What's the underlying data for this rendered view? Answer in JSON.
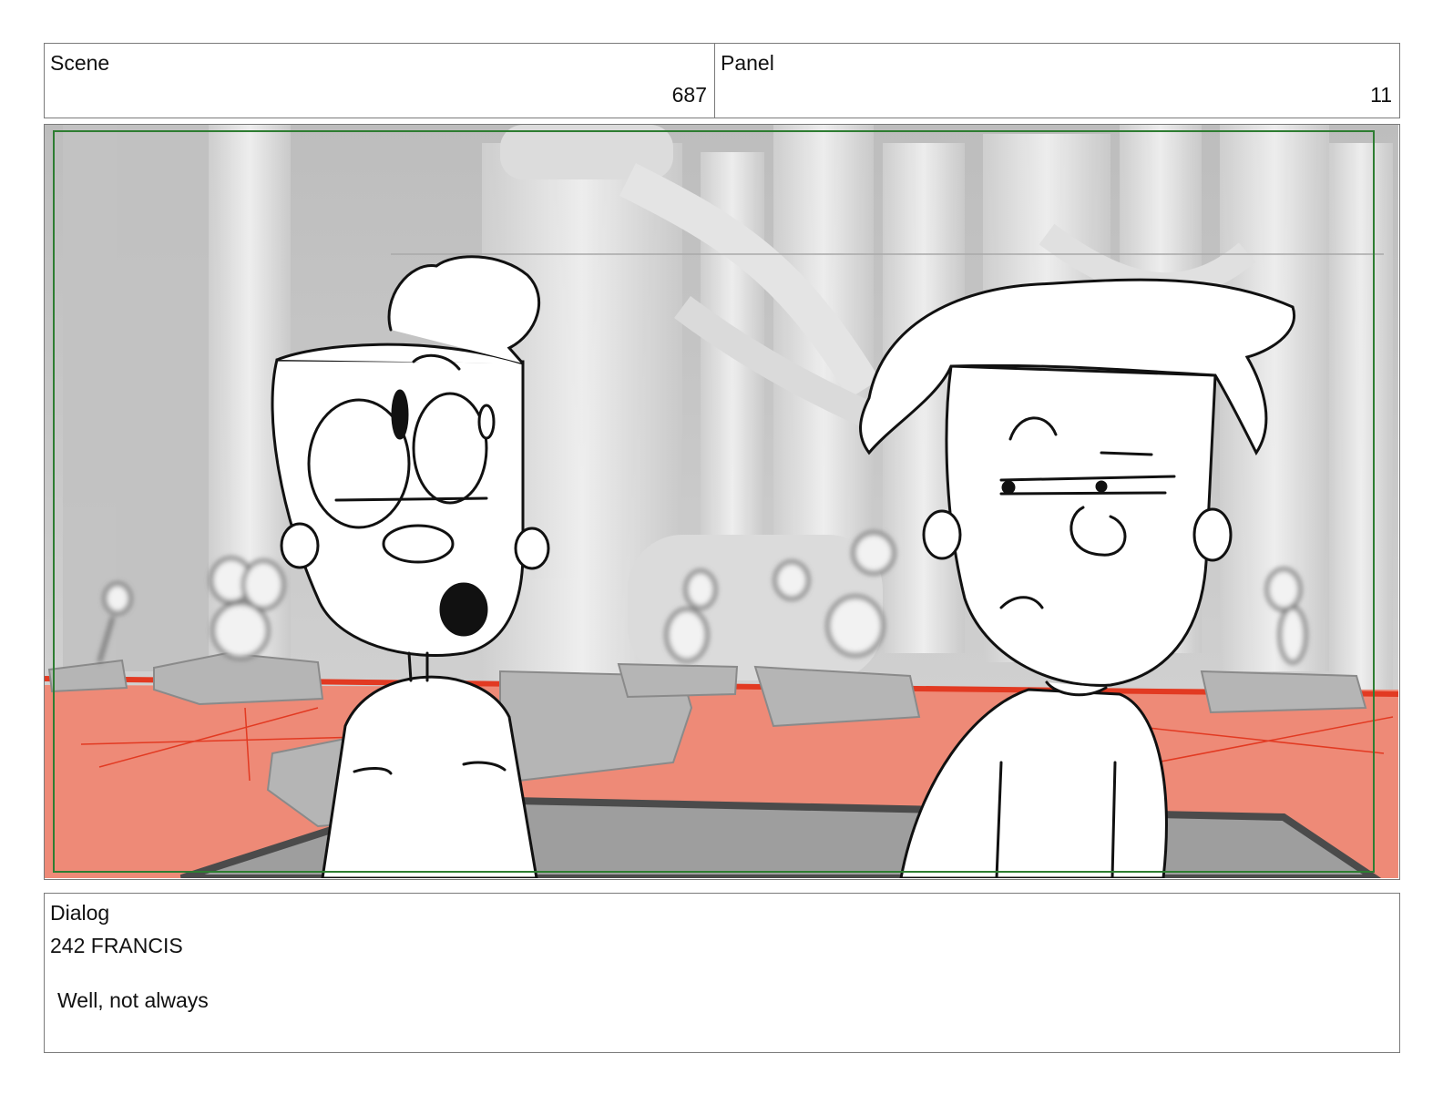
{
  "header": {
    "scene_label": "Scene",
    "scene_number": "687",
    "panel_label": "Panel",
    "panel_number": "11"
  },
  "dialog": {
    "label": "Dialog",
    "speaker": "242 FRANCIS",
    "line": "Well, not always"
  },
  "colors": {
    "floor": "#ee8a77",
    "floor_lines": "#e23a22",
    "safe_frame": "#2e7d32",
    "background_grey": "#c9c9c9"
  }
}
